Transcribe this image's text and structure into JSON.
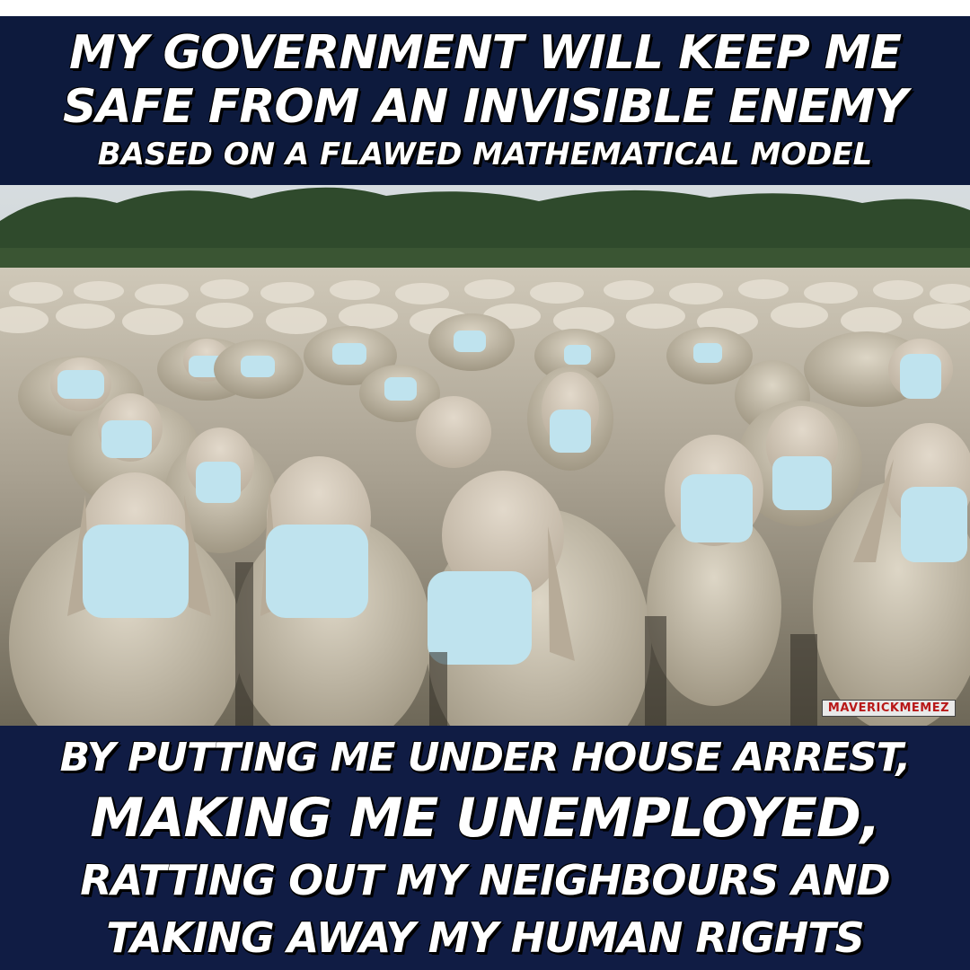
{
  "top_caption": {
    "line1": "MY GOVERNMENT WILL KEEP ME",
    "line2": "SAFE FROM AN INVISIBLE ENEMY",
    "line3": "BASED ON A FLAWED MATHEMATICAL MODEL"
  },
  "photo": {
    "watermark": "MAVERICKMEMEZ"
  },
  "bottom_caption": {
    "line1": "BY PUTTING ME UNDER HOUSE ARREST,",
    "line2": "MAKING ME UNEMPLOYED,",
    "line3": "RATTING OUT MY NEIGHBOURS AND",
    "line4": "TAKING AWAY MY HUMAN RIGHTS"
  },
  "colors": {
    "banner": "#0d1a3d",
    "caption_text": "#ffffff",
    "wool": "#c9c1ad",
    "mask": "#bfe3ee",
    "trees": "#2f4a2c"
  }
}
